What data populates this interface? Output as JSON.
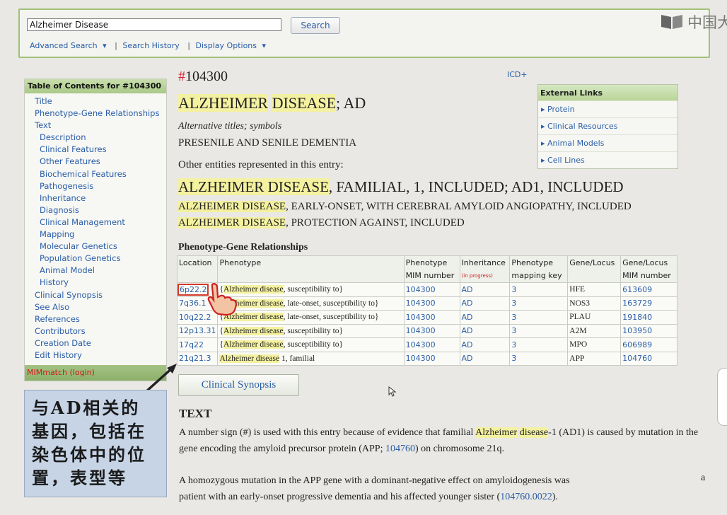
{
  "search": {
    "value": "Alzheimer Disease",
    "button": "Search",
    "links": [
      "Advanced Search",
      "Search History",
      "Display Options"
    ]
  },
  "watermark": {
    "text": "中国大"
  },
  "toc": {
    "header": "Table of Contents for #104300",
    "items": [
      {
        "label": "Title",
        "sub": false
      },
      {
        "label": "Phenotype-Gene Relationships",
        "sub": false
      },
      {
        "label": "Text",
        "sub": false
      },
      {
        "label": "Description",
        "sub": true
      },
      {
        "label": "Clinical Features",
        "sub": true
      },
      {
        "label": "Other Features",
        "sub": true
      },
      {
        "label": "Biochemical Features",
        "sub": true
      },
      {
        "label": "Pathogenesis",
        "sub": true
      },
      {
        "label": "Inheritance",
        "sub": true
      },
      {
        "label": "Diagnosis",
        "sub": true
      },
      {
        "label": "Clinical Management",
        "sub": true
      },
      {
        "label": "Mapping",
        "sub": true
      },
      {
        "label": "Molecular Genetics",
        "sub": true
      },
      {
        "label": "Population Genetics",
        "sub": true
      },
      {
        "label": "Animal Model",
        "sub": true
      },
      {
        "label": "History",
        "sub": true
      },
      {
        "label": "Clinical Synopsis",
        "sub": false
      },
      {
        "label": "See Also",
        "sub": false
      },
      {
        "label": "References",
        "sub": false
      },
      {
        "label": "Contributors",
        "sub": false
      },
      {
        "label": "Creation Date",
        "sub": false
      },
      {
        "label": "Edit History",
        "sub": false
      }
    ],
    "footer": "MIMmatch (login)"
  },
  "annotation": {
    "lines": [
      "与AD相关的",
      "基因，包括在",
      "染色体中的位",
      "置，表型等"
    ]
  },
  "entry": {
    "hash": "#",
    "number": "104300",
    "icd": "ICD+",
    "title_hl1": "ALZHEIMER",
    "title_hl2": "DISEASE",
    "title_rest": "; AD",
    "alt_label": "Alternative titles; symbols",
    "alt_value": "PRESENILE AND SENILE DEMENTIA",
    "other_label": "Other entities represented in this entry:",
    "included": [
      {
        "hl": "ALZHEIMER DISEASE",
        "rest": ", FAMILIAL, 1, INCLUDED; AD1, INCLUDED"
      },
      {
        "hl": "ALZHEIMER DISEASE",
        "rest": ", EARLY-ONSET, WITH CEREBRAL AMYLOID ANGIOPATHY, INCLUDED"
      },
      {
        "hl": "ALZHEIMER DISEASE",
        "rest": ", PROTECTION AGAINST, INCLUDED"
      }
    ]
  },
  "external_links": {
    "header": "External Links",
    "items": [
      "Protein",
      "Clinical Resources",
      "Animal Models",
      "Cell Lines"
    ]
  },
  "pgr": {
    "title": "Phenotype-Gene Relationships",
    "headers": {
      "location": "Location",
      "phenotype": "Phenotype",
      "mim_a": "Phenotype",
      "mim_b": "MIM number",
      "inh_a": "Inheritance",
      "inh_b": "(in progress)",
      "key_a": "Phenotype",
      "key_b": "mapping key",
      "gene": "Gene/Locus",
      "gmim_a": "Gene/Locus",
      "gmim_b": "MIM number"
    },
    "rows": [
      {
        "loc": "6p22.2",
        "pre": "{",
        "hl": "Alzheimer disease",
        "post": ", susceptibility to}",
        "mim": "104300",
        "inh": "AD",
        "key": "3",
        "gene": "HFE",
        "gmim": "613609"
      },
      {
        "loc": "7q36.1",
        "pre": "{",
        "hl": "Alzheimer disease",
        "post": ", late-onset, susceptibility to}",
        "mim": "104300",
        "inh": "AD",
        "key": "3",
        "gene": "NOS3",
        "gmim": "163729"
      },
      {
        "loc": "10q22.2",
        "pre": "{",
        "hl": "Alzheimer disease",
        "post": ", late-onset, susceptibility to}",
        "mim": "104300",
        "inh": "AD",
        "key": "3",
        "gene": "PLAU",
        "gmim": "191840"
      },
      {
        "loc": "12p13.31",
        "pre": "{",
        "hl": "Alzheimer disease",
        "post": ", susceptibility to}",
        "mim": "104300",
        "inh": "AD",
        "key": "3",
        "gene": "A2M",
        "gmim": "103950"
      },
      {
        "loc": "17q22",
        "pre": "{",
        "hl": "Alzheimer disease",
        "post": ", susceptibility to}",
        "mim": "104300",
        "inh": "AD",
        "key": "3",
        "gene": "MPO",
        "gmim": "606989"
      },
      {
        "loc": "21q21.3",
        "pre": "",
        "hl": "Alzheimer disease",
        "post": " 1, familial",
        "mim": "104300",
        "inh": "AD",
        "key": "3",
        "gene": "APP",
        "gmim": "104760"
      }
    ]
  },
  "clinical_synopsis_button": "Clinical Synopsis",
  "text_section": {
    "heading": "TEXT",
    "p1_a": "A number sign (#) is used with this entry because of evidence that familial ",
    "p1_hl1": "Alzheimer",
    "p1_hl2": "disease",
    "p1_b": "-1 (AD1) is caused by mutation in the gene encoding the amyloid precursor protein (APP; ",
    "p1_link": "104760",
    "p1_c": ") on chromosome 21q.",
    "p2_a": "A homozygous mutation in the APP gene with a dominant-negative effect on amyloidogenesis was",
    "p2_stub": "a",
    "p2_b": "patient with an early-onset progressive dementia and his affected younger sister (",
    "p2_link": "104760.0022",
    "p2_c": ")."
  }
}
